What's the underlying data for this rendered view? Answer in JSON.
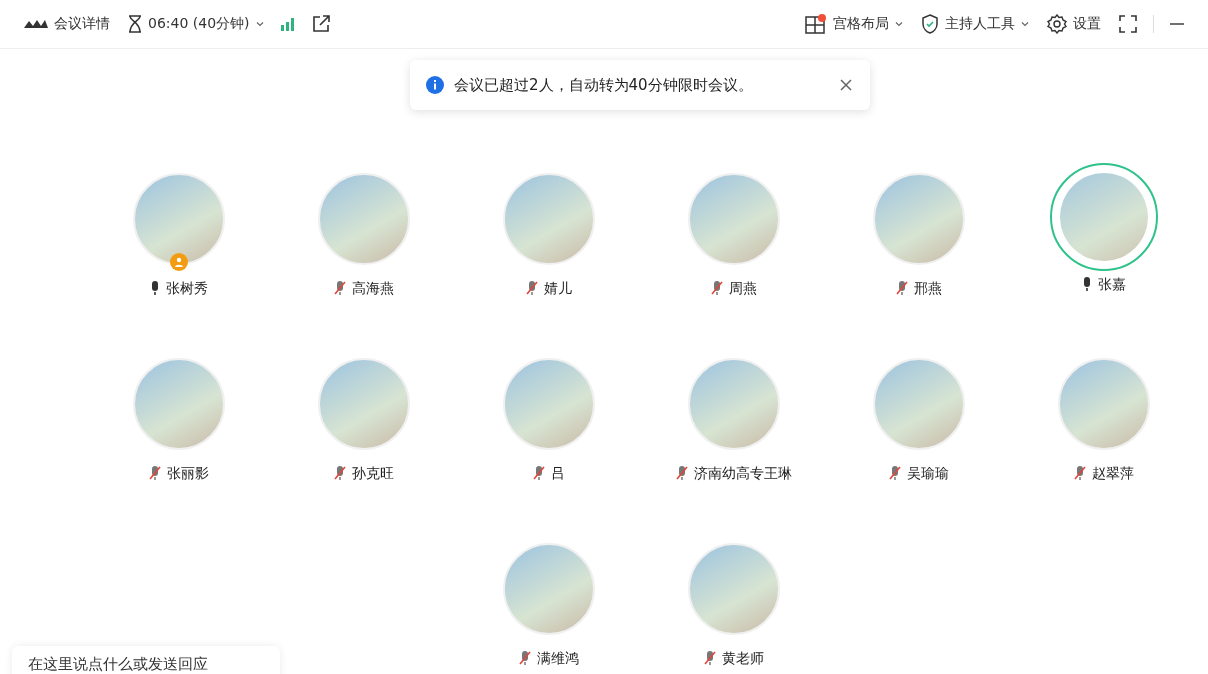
{
  "toolbar": {
    "meeting_info": "会议详情",
    "timer": "06:40 (40分钟)",
    "layout": {
      "label": "宫格布局",
      "has_notice": true
    },
    "host_tools": "主持人工具",
    "settings": "设置"
  },
  "toast": {
    "message": "会议已超过2人，自动转为40分钟限时会议。"
  },
  "participants": [
    {
      "name": "张树秀",
      "muted": false,
      "host": true,
      "speaking": false
    },
    {
      "name": "高海燕",
      "muted": true,
      "host": false,
      "speaking": false
    },
    {
      "name": "婧儿",
      "muted": true,
      "host": false,
      "speaking": false
    },
    {
      "name": "周燕",
      "muted": true,
      "host": false,
      "speaking": false
    },
    {
      "name": "邢燕",
      "muted": true,
      "host": false,
      "speaking": false
    },
    {
      "name": "张嘉",
      "muted": false,
      "host": false,
      "speaking": true
    },
    {
      "name": "张丽影",
      "muted": true,
      "host": false,
      "speaking": false
    },
    {
      "name": "孙克旺",
      "muted": true,
      "host": false,
      "speaking": false
    },
    {
      "name": "吕",
      "muted": true,
      "host": false,
      "speaking": false
    },
    {
      "name": "济南幼高专王琳",
      "muted": true,
      "host": false,
      "speaking": false
    },
    {
      "name": "吴瑜瑜",
      "muted": true,
      "host": false,
      "speaking": false
    },
    {
      "name": "赵翠萍",
      "muted": true,
      "host": false,
      "speaking": false
    },
    {
      "name": "满维鸿",
      "muted": true,
      "host": false,
      "speaking": false
    },
    {
      "name": "黄老师",
      "muted": true,
      "host": false,
      "speaking": false
    }
  ],
  "chat_input": {
    "placeholder": "在这里说点什么或发送回应"
  }
}
